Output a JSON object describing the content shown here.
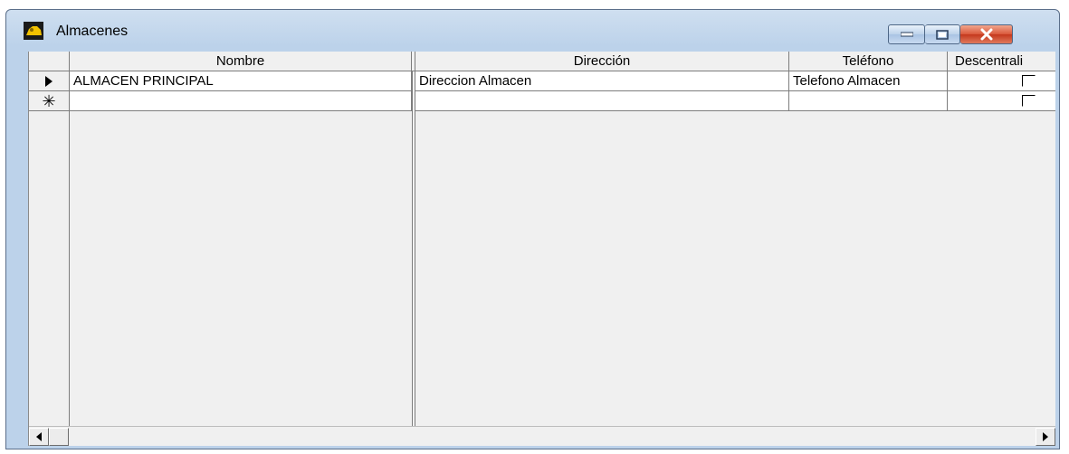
{
  "window": {
    "title": "Almacenes",
    "controls": {
      "minimize": "minimize",
      "maximize": "maximize",
      "close": "close"
    }
  },
  "grid": {
    "columns": [
      "Nombre",
      "Dirección",
      "Teléfono",
      "Descentrali"
    ],
    "rows": [
      {
        "indicator": "current",
        "nombre": "ALMACEN PRINCIPAL",
        "direccion": "Direccion Almacen",
        "telefono": "Telefono Almacen",
        "descentralizado": false
      },
      {
        "indicator": "new",
        "nombre": "",
        "direccion": "",
        "telefono": "",
        "descentralizado": false
      }
    ]
  },
  "icons": {
    "app": "app-icon",
    "current_row": "play-arrow-icon",
    "new_row": "asterisk-icon",
    "scroll_left": "arrow-left-icon",
    "scroll_right": "arrow-right-icon"
  },
  "colors": {
    "titlebar": "#bcd2ea",
    "close_button": "#d9573a",
    "grid_background": "#f0f0f0",
    "cell_background": "#ffffff"
  }
}
